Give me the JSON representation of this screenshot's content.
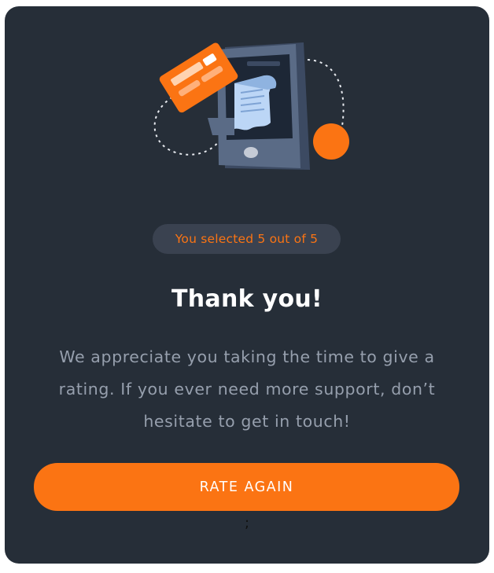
{
  "illustration": {
    "icon": "payment-phone-illustration-icon",
    "accent": "#fb7413"
  },
  "badge": {
    "text": "You selected 5 out of 5",
    "selected": 5,
    "total": 5
  },
  "title": "Thank you!",
  "message": "We appreciate you taking the time to give a rating. If you ever need more support, don’t hesitate to get in touch!",
  "button": {
    "label": "RATE AGAIN"
  },
  "stray_text": ";",
  "colors": {
    "card_background": "#262e38",
    "accent": "#fb7413",
    "badge_background": "#3a4250",
    "muted_text": "#969fad",
    "title_text": "#ffffff"
  }
}
